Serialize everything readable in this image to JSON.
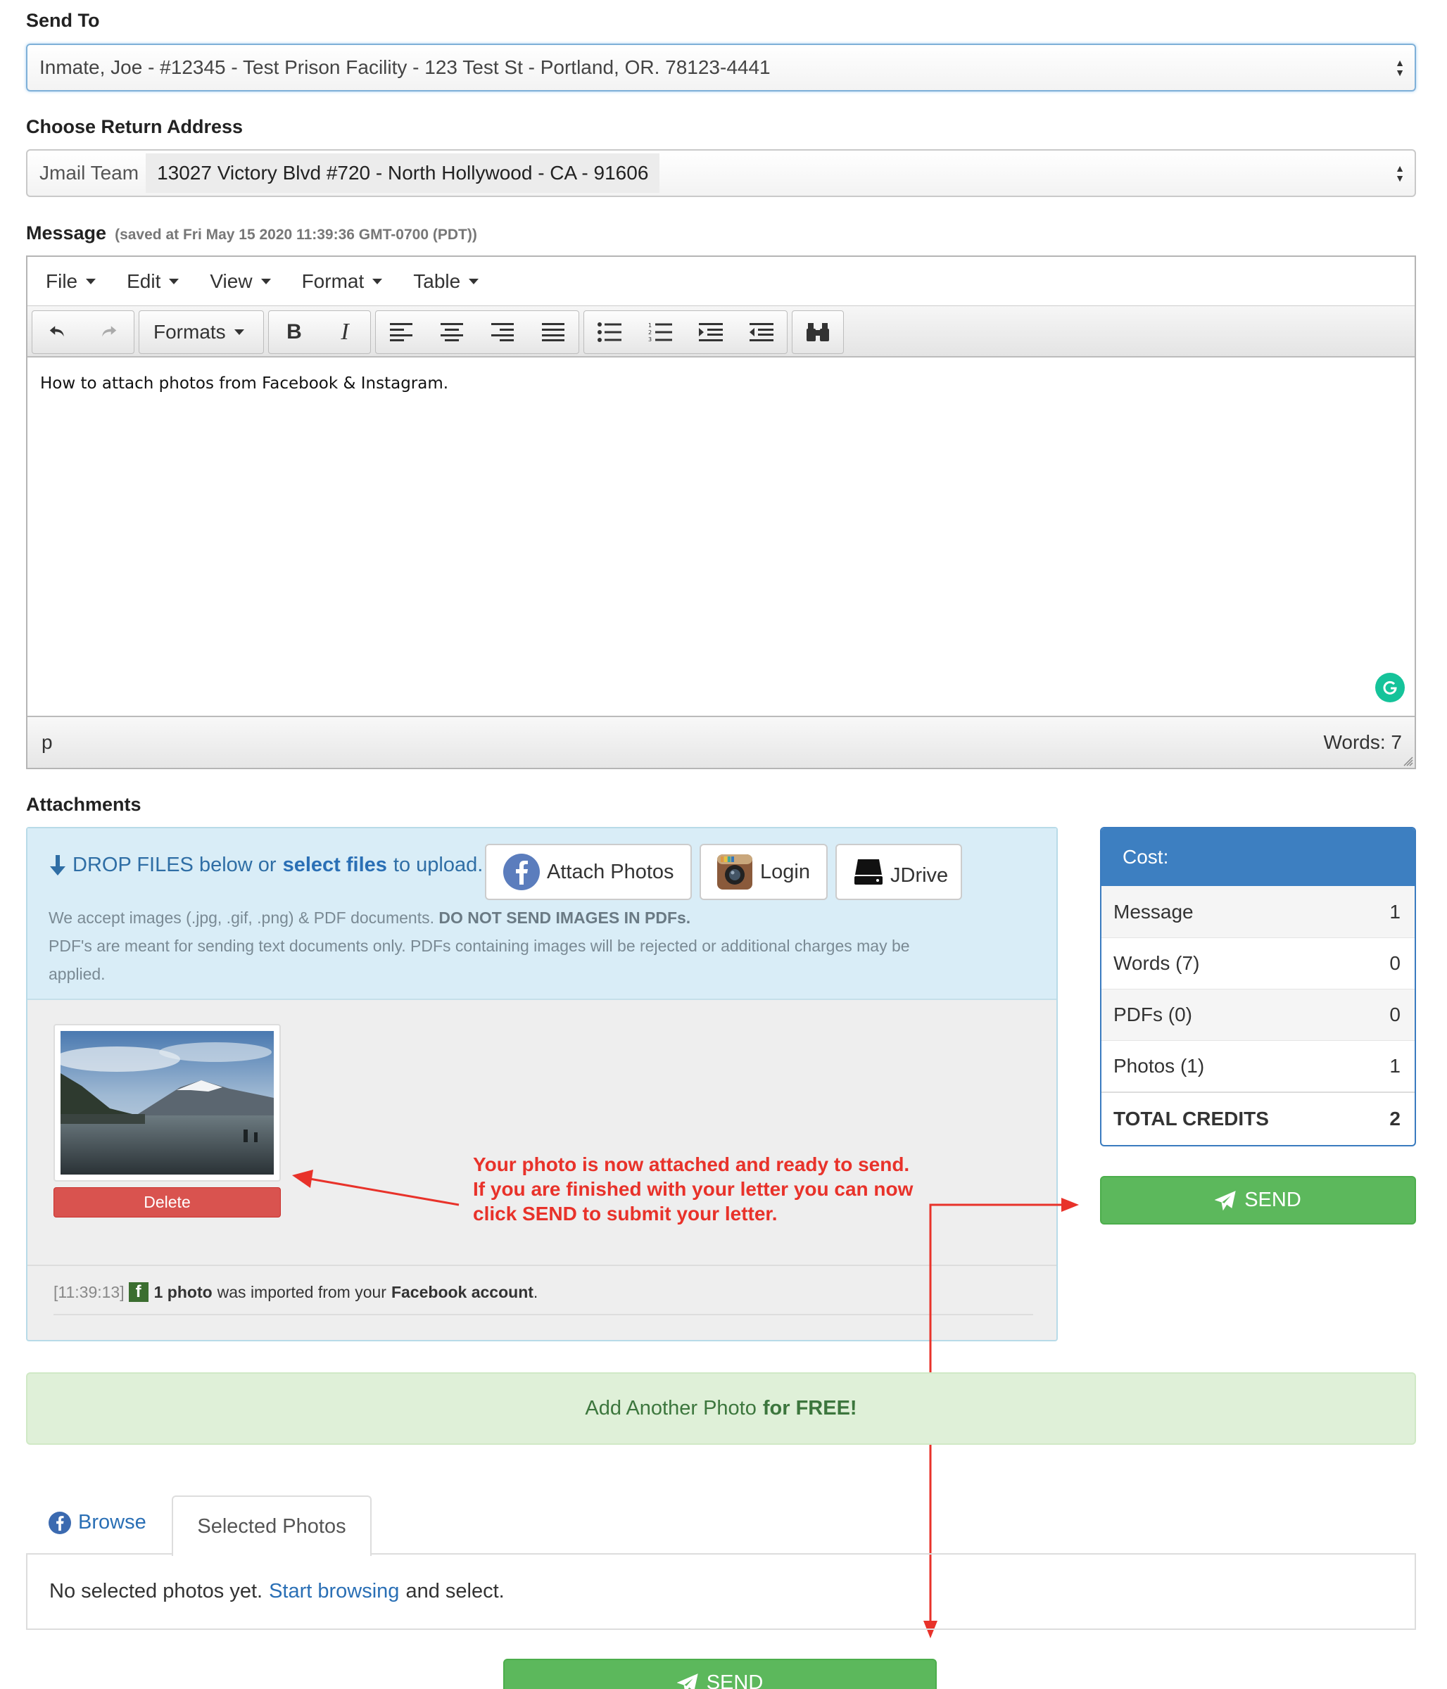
{
  "send_to": {
    "label": "Send To",
    "selected": "Inmate, Joe - #12345 - Test Prison Facility - 123 Test St - Portland, OR. 78123-4441"
  },
  "return_address": {
    "label": "Choose Return Address",
    "name": "Jmail Team",
    "address": "13027 Victory Blvd #720 - North Hollywood - CA - 91606"
  },
  "message": {
    "label": "Message",
    "saved_note": "(saved at Fri May 15 2020 11:39:36 GMT-0700 (PDT))",
    "menu": [
      "File",
      "Edit",
      "View",
      "Format",
      "Table"
    ],
    "formats_label": "Formats",
    "body": "How to attach photos from Facebook & Instagram.",
    "path": "p",
    "word_count": "Words: 7"
  },
  "attachments": {
    "label": "Attachments",
    "drop_prefix": "DROP FILES below or",
    "select_files": "select files",
    "drop_suffix": "to upload.",
    "attach_photos": "Attach Photos",
    "login": "Login",
    "jdrive": "JDrive",
    "accept_text": "We accept images (.jpg, .gif, .png) & PDF documents.",
    "accept_warning": "DO NOT SEND IMAGES IN PDFs.",
    "pdf_note": "PDF's are meant for sending text documents only. PDFs containing images will be rejected or additional charges may be applied.",
    "delete_label": "Delete",
    "log_time": "[11:39:13]",
    "log_count": "1 photo",
    "log_mid": "was imported from your",
    "log_source": "Facebook account",
    "log_end": "."
  },
  "annotation": {
    "line1": "Your photo is now attached and ready to send.",
    "line2": "If you are finished with your letter you can now",
    "line3": "click SEND to submit your letter."
  },
  "cost": {
    "title": "Cost:",
    "rows": [
      {
        "label": "Message",
        "value": "1"
      },
      {
        "label": "Words (7)",
        "value": "0"
      },
      {
        "label": "PDFs (0)",
        "value": "0"
      },
      {
        "label": "Photos (1)",
        "value": "1"
      }
    ],
    "total_label": "TOTAL CREDITS",
    "total_value": "2"
  },
  "send_label": "SEND",
  "add_photo": {
    "prefix": "Add Another Photo",
    "strong": "for FREE!"
  },
  "tabs": {
    "browse": "Browse",
    "selected": "Selected Photos",
    "empty_prefix": "No selected photos yet.",
    "empty_link": "Start browsing",
    "empty_suffix": "and select."
  },
  "colors": {
    "green": "#5cb85c",
    "blue": "#3d7fc1",
    "red": "#d9534f",
    "annotation": "#e8322a"
  }
}
